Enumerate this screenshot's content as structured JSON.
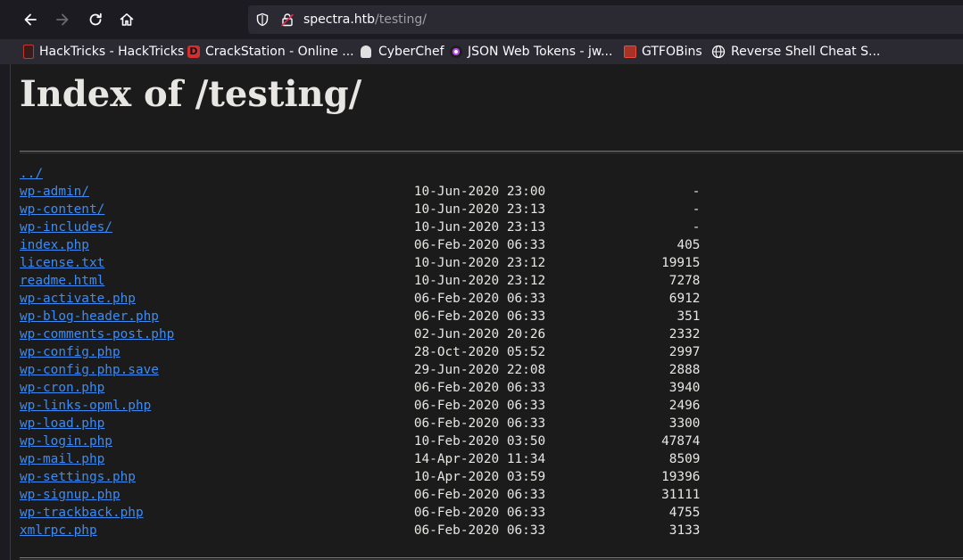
{
  "browser": {
    "url_host": "spectra.htb",
    "url_path": "/testing/",
    "bookmarks": [
      {
        "label": "HackTricks - HackTricks",
        "icon": "hacktricks-icon",
        "color": "#c0392b"
      },
      {
        "label": "CrackStation - Online ...",
        "icon": "crackstation-icon",
        "color": "#d32f2f"
      },
      {
        "label": "CyberChef",
        "icon": "cyberchef-icon",
        "color": "#e0e0e0"
      },
      {
        "label": "JSON Web Tokens - jw...",
        "icon": "jwt-icon",
        "color": "#b84be6"
      },
      {
        "label": "GTFOBins",
        "icon": "gtfobins-icon",
        "color": "#a93226"
      },
      {
        "label": "Reverse Shell Cheat S...",
        "icon": "globe-icon",
        "color": "#fbfbfe"
      }
    ]
  },
  "page": {
    "title": "Index of /testing/",
    "parent_link": "../",
    "entries": [
      {
        "name": "wp-admin/",
        "date": "10-Jun-2020 23:00",
        "size": "-"
      },
      {
        "name": "wp-content/",
        "date": "10-Jun-2020 23:13",
        "size": "-"
      },
      {
        "name": "wp-includes/",
        "date": "10-Jun-2020 23:13",
        "size": "-"
      },
      {
        "name": "index.php",
        "date": "06-Feb-2020 06:33",
        "size": "405"
      },
      {
        "name": "license.txt",
        "date": "10-Jun-2020 23:12",
        "size": "19915"
      },
      {
        "name": "readme.html",
        "date": "10-Jun-2020 23:12",
        "size": "7278"
      },
      {
        "name": "wp-activate.php",
        "date": "06-Feb-2020 06:33",
        "size": "6912"
      },
      {
        "name": "wp-blog-header.php",
        "date": "06-Feb-2020 06:33",
        "size": "351"
      },
      {
        "name": "wp-comments-post.php",
        "date": "02-Jun-2020 20:26",
        "size": "2332"
      },
      {
        "name": "wp-config.php",
        "date": "28-Oct-2020 05:52",
        "size": "2997"
      },
      {
        "name": "wp-config.php.save",
        "date": "29-Jun-2020 22:08",
        "size": "2888"
      },
      {
        "name": "wp-cron.php",
        "date": "06-Feb-2020 06:33",
        "size": "3940"
      },
      {
        "name": "wp-links-opml.php",
        "date": "06-Feb-2020 06:33",
        "size": "2496"
      },
      {
        "name": "wp-load.php",
        "date": "06-Feb-2020 06:33",
        "size": "3300"
      },
      {
        "name": "wp-login.php",
        "date": "10-Feb-2020 03:50",
        "size": "47874"
      },
      {
        "name": "wp-mail.php",
        "date": "14-Apr-2020 11:34",
        "size": "8509"
      },
      {
        "name": "wp-settings.php",
        "date": "10-Apr-2020 03:59",
        "size": "19396"
      },
      {
        "name": "wp-signup.php",
        "date": "06-Feb-2020 06:33",
        "size": "31111"
      },
      {
        "name": "wp-trackback.php",
        "date": "06-Feb-2020 06:33",
        "size": "4755"
      },
      {
        "name": "xmlrpc.php",
        "date": "06-Feb-2020 06:33",
        "size": "3133"
      }
    ]
  }
}
